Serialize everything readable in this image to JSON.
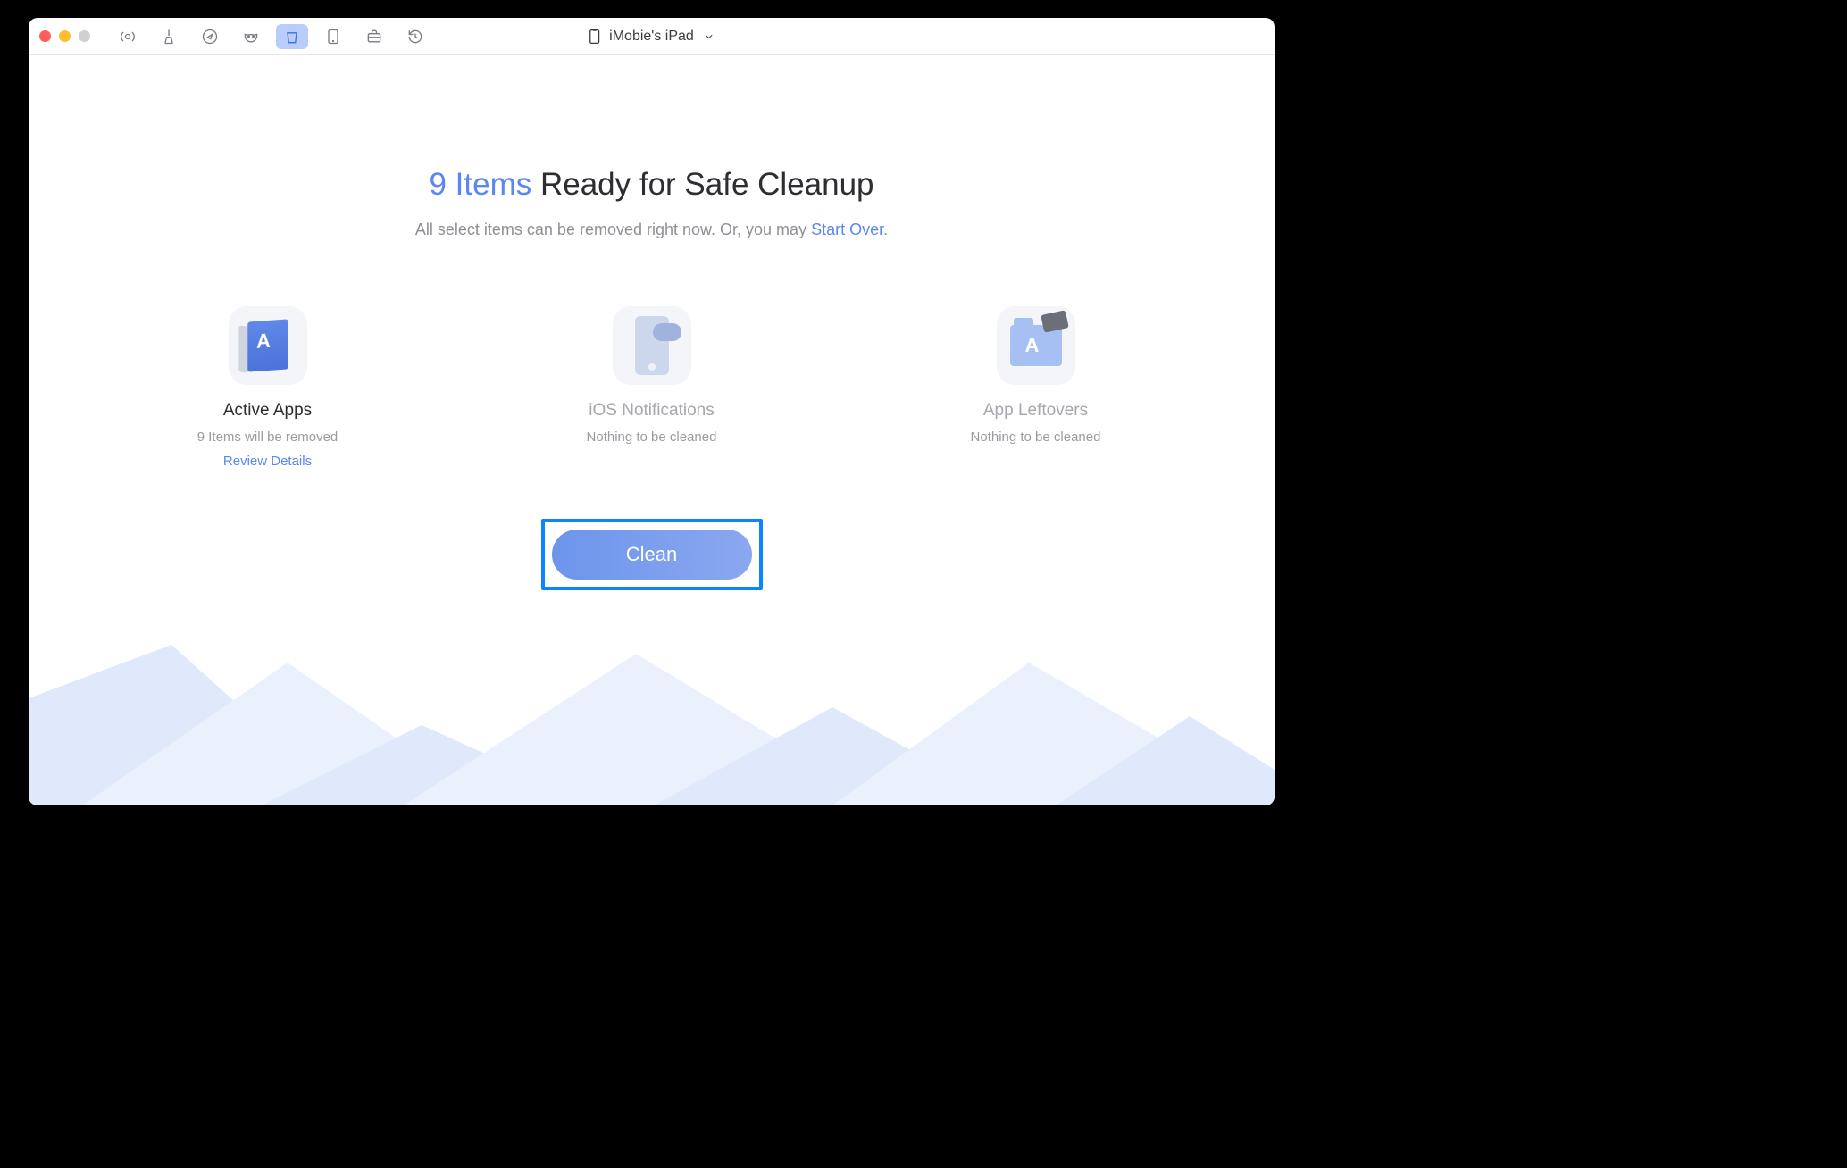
{
  "device": {
    "name": "iMobie's iPad"
  },
  "toolbar": {
    "icons": [
      "airplay",
      "broom",
      "compass",
      "mask",
      "trash",
      "ipad",
      "briefcase",
      "history"
    ],
    "active_index": 4
  },
  "headline": {
    "count": "9 Items",
    "rest": " Ready for Safe Cleanup"
  },
  "subline": {
    "prefix": "All select items can be removed right now. Or, you may ",
    "link": "Start Over",
    "suffix": "."
  },
  "categories": [
    {
      "title": "Active Apps",
      "subtitle": "9 Items will be removed",
      "review_link": "Review Details",
      "enabled": true,
      "icon": "active-apps-icon"
    },
    {
      "title": "iOS Notifications",
      "subtitle": "Nothing to be cleaned",
      "enabled": false,
      "icon": "ios-notifications-icon"
    },
    {
      "title": "App Leftovers",
      "subtitle": "Nothing to be cleaned",
      "enabled": false,
      "icon": "app-leftovers-icon"
    }
  ],
  "clean_button": {
    "label": "Clean"
  },
  "colors": {
    "accent": "#5a87f2",
    "highlight_border": "#0a84ff",
    "text_muted": "#8f8f97"
  }
}
